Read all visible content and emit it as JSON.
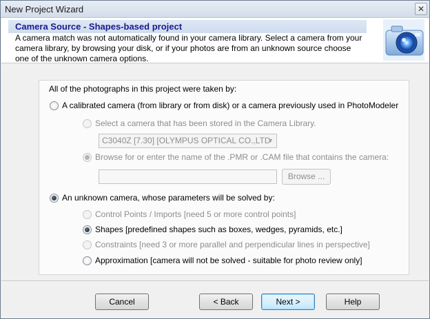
{
  "window": {
    "title": "New Project Wizard",
    "close_glyph": "✕"
  },
  "header": {
    "heading": "Camera Source - Shapes-based project",
    "description": "A camera match was not automatically found in your camera library. Select a camera from your camera library, by browsing your disk, or if your photos are from an unknown source choose one of the unknown camera options.",
    "icon": "camera-icon"
  },
  "form": {
    "intro": "All of the photographs in this project were taken by:",
    "calibrated": {
      "label": "A calibrated camera (from library or from disk) or a camera previously used in PhotoModeler",
      "selected": false,
      "library_option": {
        "label": "Select a camera that has been stored in the Camera Library.",
        "selected": false,
        "enabled": false
      },
      "library_combo": {
        "value": "C3040Z [7.30] [OLYMPUS OPTICAL CO.,LTD",
        "enabled": false
      },
      "browse_option": {
        "label": "Browse for or enter the name of the .PMR or .CAM file that contains the camera:",
        "selected": true,
        "enabled": false
      },
      "file_field": {
        "value": "",
        "enabled": false
      },
      "browse_button": "Browse ..."
    },
    "unknown": {
      "label": "An unknown camera, whose parameters will be solved by:",
      "selected": true,
      "options": [
        {
          "label": "Control Points / Imports [need 5 or more control points]",
          "selected": false,
          "enabled": false
        },
        {
          "label": "Shapes [predefined shapes such as boxes, wedges, pyramids, etc.]",
          "selected": true,
          "enabled": true
        },
        {
          "label": "Constraints [need 3 or more parallel and perpendicular lines in perspective]",
          "selected": false,
          "enabled": false
        },
        {
          "label": "Approximation [camera will not be solved - suitable for photo review only]",
          "selected": false,
          "enabled": true
        }
      ]
    }
  },
  "buttons": {
    "cancel": "Cancel",
    "back": "< Back",
    "next": "Next >",
    "help": "Help"
  },
  "colors": {
    "heading_text": "#1a1a8c",
    "heading_bg": "#cfdcef",
    "default_button_border": "#3c7fb1"
  }
}
